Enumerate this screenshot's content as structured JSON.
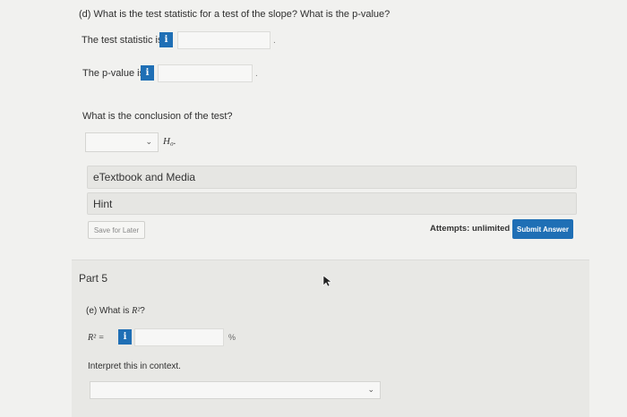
{
  "question_d": {
    "prompt": "(d) What is the test statistic for a test of the slope? What is the p-value?",
    "test_stat_label": "The test statistic is",
    "p_value_label": "The p-value is",
    "info_glyph": "i",
    "trailing": "."
  },
  "conclusion": {
    "prompt": "What is the conclusion of the test?",
    "select_value": "",
    "suffix": "H₀."
  },
  "resources": {
    "etextbook_label": "eTextbook and Media",
    "hint_label": "Hint"
  },
  "actions": {
    "save_later": "Save for Later",
    "attempts_text": "Attempts: unlimited",
    "submit": "Submit Answer"
  },
  "part5": {
    "title": "Part 5",
    "question_e_prefix": "(e) What is",
    "question_e_var": "R²",
    "question_e_suffix": "?",
    "r2_label": "R² =",
    "percent": "%",
    "interpret_prompt": "Interpret this in context.",
    "interpret_select_value": ""
  },
  "colors": {
    "accent": "#1f6fb5",
    "background": "#f1f1ef"
  },
  "icons": {
    "info": "info-icon",
    "chevron": "chevron-down-icon",
    "cursor": "mouse-cursor-icon"
  }
}
